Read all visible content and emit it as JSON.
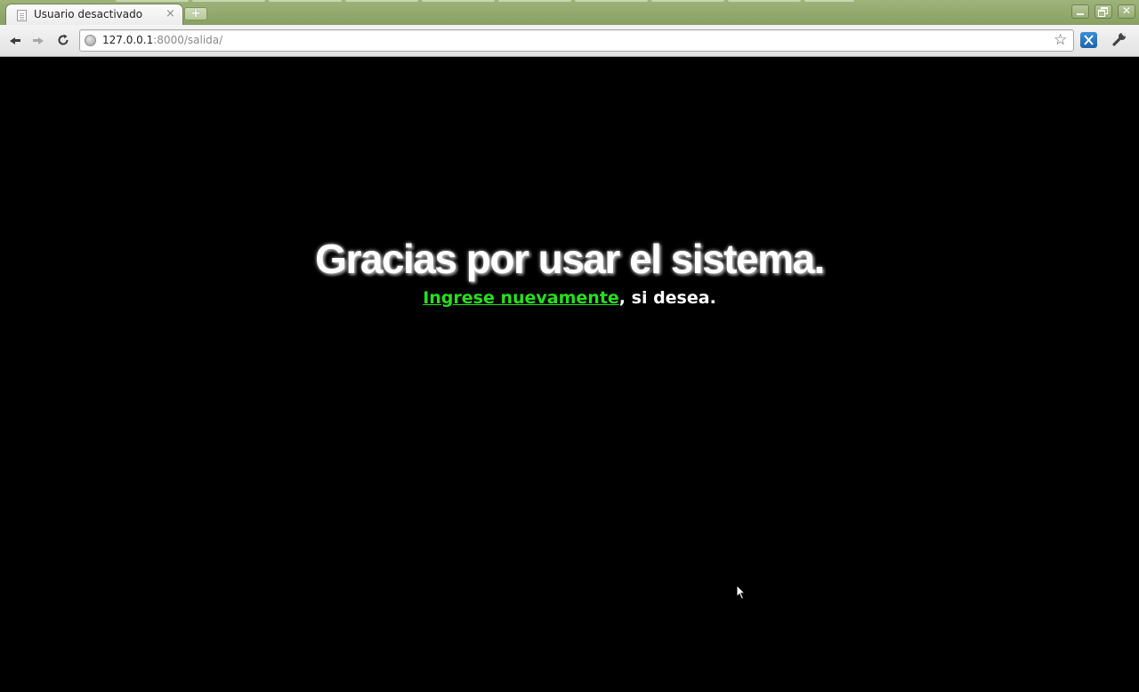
{
  "browser": {
    "tab": {
      "title": "Usuario desactivado",
      "close_glyph": "×"
    },
    "new_tab_glyph": "+",
    "window_buttons": {
      "close_glyph": "✕"
    },
    "address": {
      "host": "127.0.0.1",
      "rest": ":8000/salida/"
    },
    "icons": {
      "page": "document-icon",
      "globe": "globe-icon",
      "star": "star-icon",
      "extension": "extension-icon",
      "wrench": "wrench-icon"
    }
  },
  "page": {
    "heading": "Gracias por usar el sistema.",
    "link_text": "Ingrese nuevamente",
    "after_link": ", si desea.",
    "colors": {
      "background": "#000000",
      "text": "#ffffff",
      "link": "#25e01b"
    }
  }
}
